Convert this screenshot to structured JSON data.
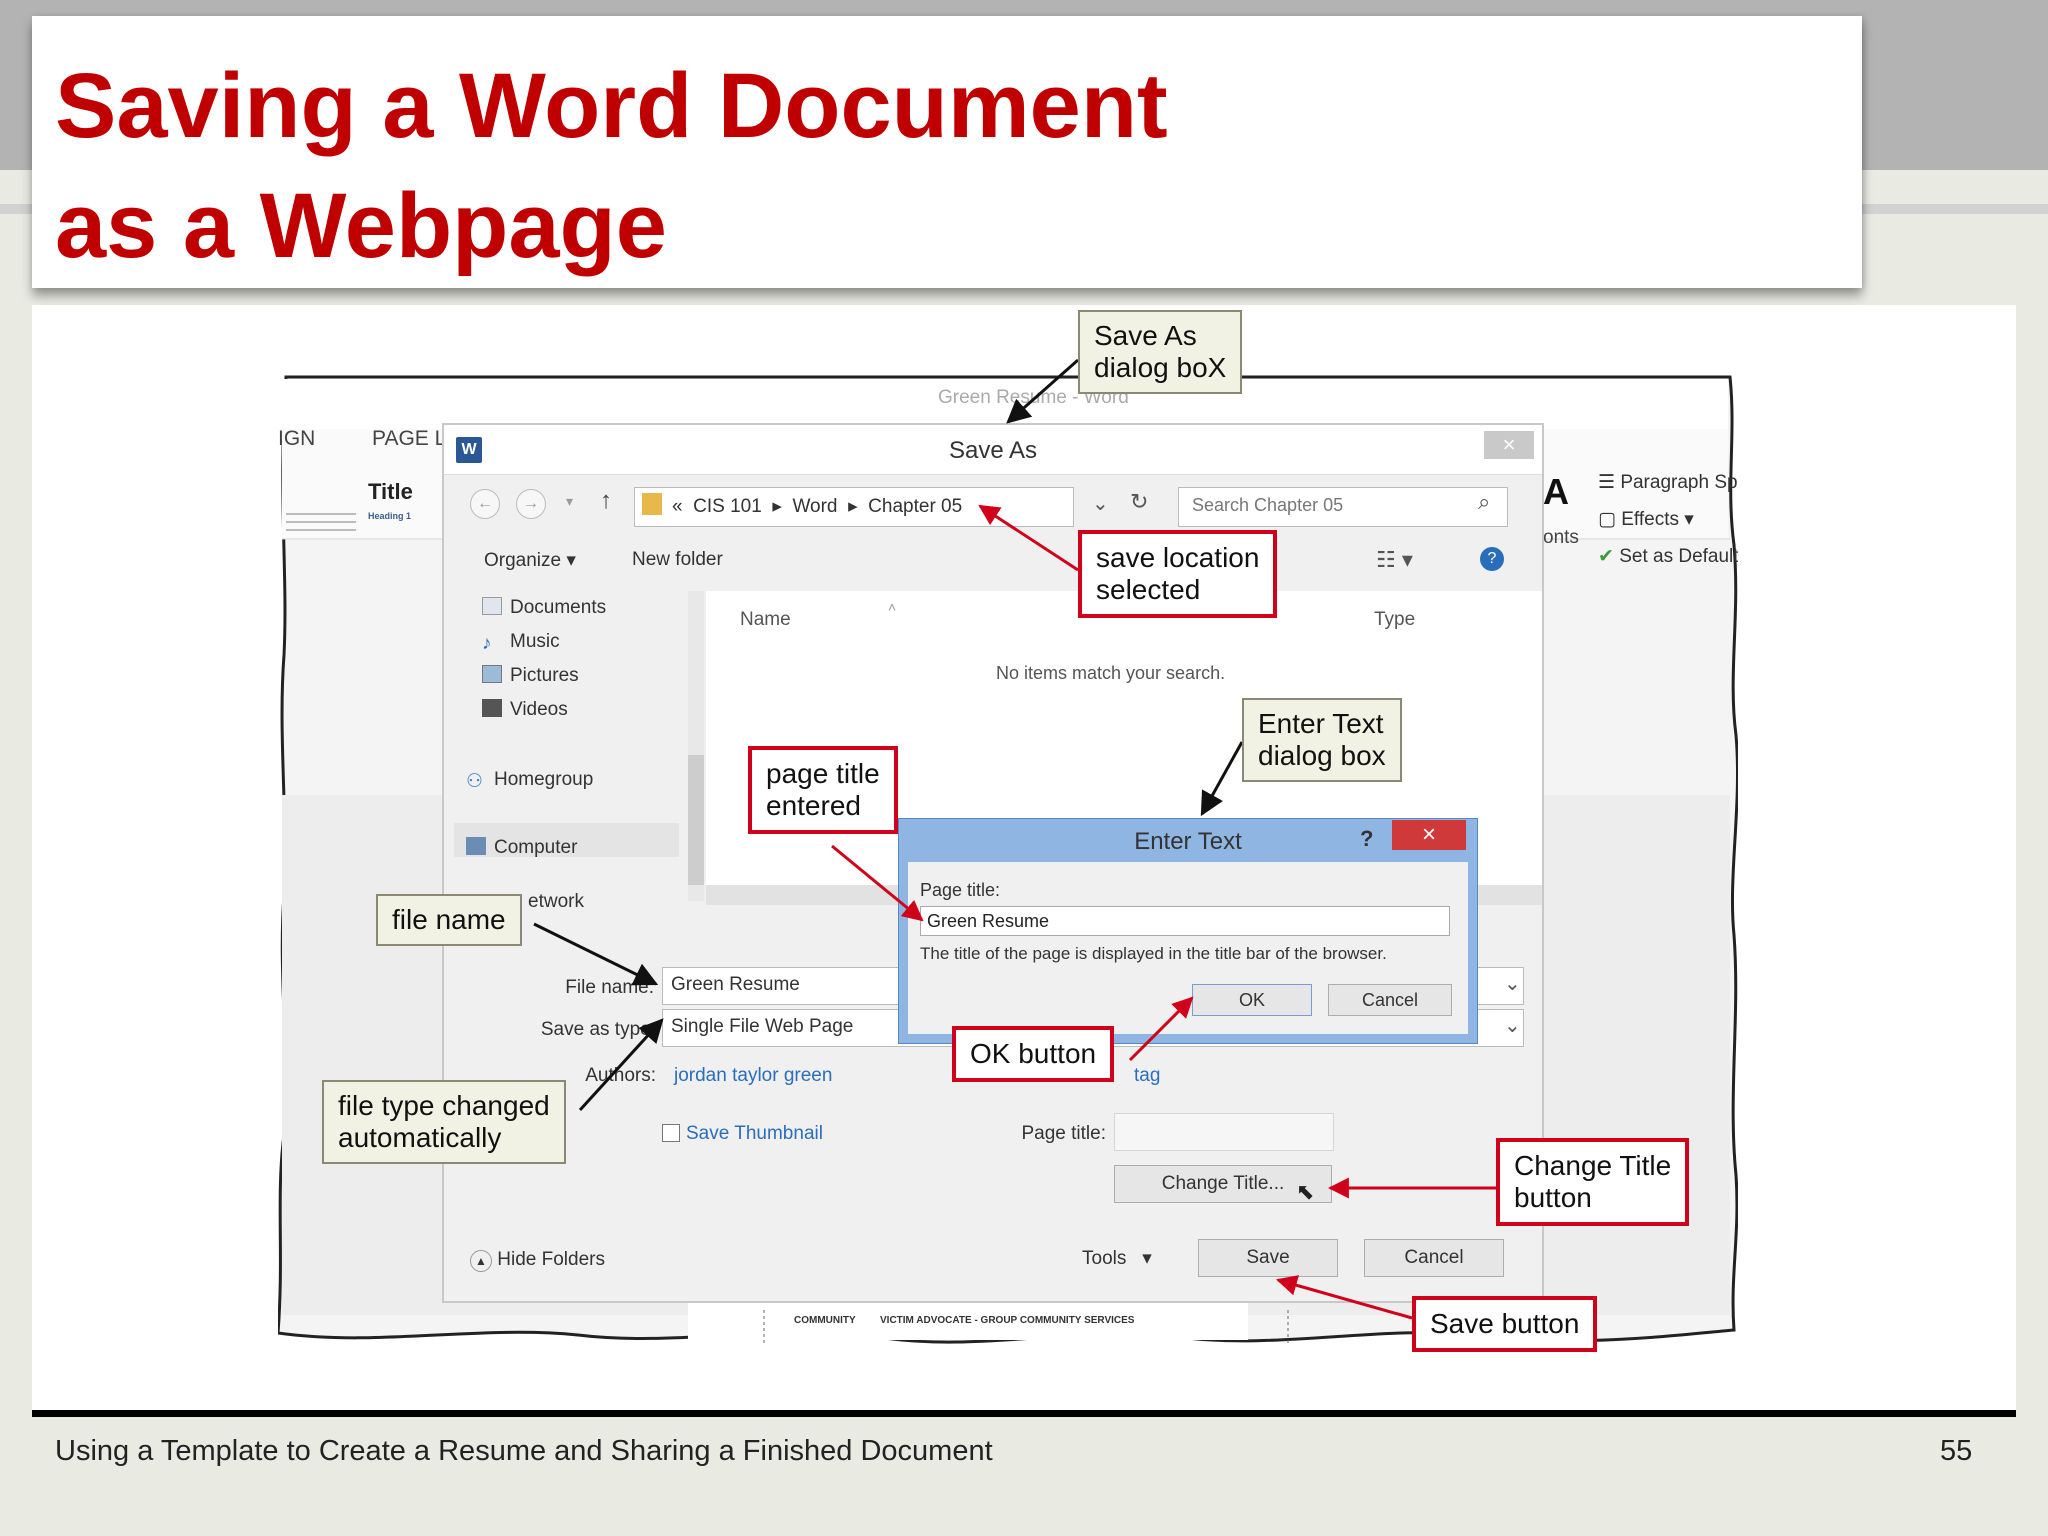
{
  "slide": {
    "title_line1": "Saving a Word Document",
    "title_line2": "as a Webpage",
    "footer": "Using a Template to Create a Resume and Sharing a Finished Document",
    "page_number": "55"
  },
  "word": {
    "window_title": "Green Resume - Word",
    "ribbon_tab_design": "IGN",
    "ribbon_tab_page": "PAGE LA",
    "style_title": "Title",
    "style_heading": "Heading 1",
    "ribbon_paragraph": "Paragraph Sp",
    "ribbon_effects": "Effects",
    "ribbon_default": "Set as Default",
    "ribbon_fonts": "onts",
    "ribbon_a": "A",
    "doc_snippet_1": "COMMUNITY",
    "doc_snippet_2": "VICTIM ADVOCATE - GROUP COMMUNITY SERVICES"
  },
  "save_as": {
    "title": "Save As",
    "close": "×",
    "address": [
      "«",
      "CIS 101",
      "Word",
      "Chapter 05"
    ],
    "search_placeholder": "Search Chapter 05",
    "organize": "Organize",
    "new_folder": "New folder",
    "nav_items": [
      "Documents",
      "Music",
      "Pictures",
      "Videos",
      "Homegroup",
      "Computer",
      "etwork"
    ],
    "col_name": "Name",
    "col_type": "Type",
    "no_items": "No items match your search.",
    "file_name_label": "File name:",
    "file_name_value": "Green Resume",
    "save_type_label": "Save as type:",
    "save_type_value": "Single File Web Page",
    "authors_label": "Authors:",
    "authors_value": "jordan taylor green",
    "tags_value": "tag",
    "save_thumbnail": "Save Thumbnail",
    "page_title_label": "Page title:",
    "change_title": "Change Title...",
    "hide_folders": "Hide Folders",
    "tools": "Tools",
    "save": "Save",
    "cancel": "Cancel"
  },
  "enter_text": {
    "title": "Enter Text",
    "help": "?",
    "close": "×",
    "page_title_label": "Page title:",
    "page_title_value": "Green Resume",
    "description": "The title of the page is displayed in the title bar of the browser.",
    "ok": "OK",
    "cancel": "Cancel"
  },
  "callouts": {
    "save_as_dialog": [
      "Save As",
      "dialog boX"
    ],
    "save_location": [
      "save location",
      "selected"
    ],
    "enter_text_dialog": [
      "Enter Text",
      "dialog box"
    ],
    "page_title_entered": [
      "page title",
      "entered"
    ],
    "file_name": "file name",
    "file_type_changed": [
      "file type changed",
      "automatically"
    ],
    "ok_button": "OK button",
    "change_title_button": [
      "Change Title",
      "button"
    ],
    "save_button": "Save button"
  },
  "colors": {
    "title_red": "#c00000",
    "callout_red": "#d0021b",
    "callout_gray_bg": "#f2f2e4",
    "dialog_blue": "#8fb6e3"
  }
}
